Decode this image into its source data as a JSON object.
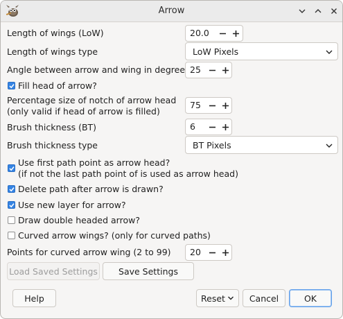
{
  "window": {
    "title": "Arrow",
    "app_icon": "gimp-wilber-icon",
    "controls": [
      "chevron-down-icon",
      "chevron-up-icon",
      "close-icon"
    ]
  },
  "fields": {
    "length_of_wings": {
      "label": "Length of wings (LoW)",
      "value": "20.0"
    },
    "length_of_wings_type": {
      "label": "Length of wings type",
      "value": "LoW Pixels"
    },
    "angle": {
      "label": "Angle between arrow and wing in degrees",
      "value": "25"
    },
    "fill_head": {
      "label": "Fill head of arrow?",
      "checked": true
    },
    "notch": {
      "label_line1": "Percentage size of notch of arrow head",
      "label_line2": "(only valid if head of arrow is filled)",
      "value": "75"
    },
    "brush_thickness": {
      "label": "Brush thickness (BT)",
      "value": "6"
    },
    "brush_thickness_type": {
      "label": "Brush thickness type",
      "value": "BT Pixels"
    },
    "use_first_point": {
      "label_line1": "Use first path point as arrow head?",
      "label_line2": "(if not the last path point of is used as arrow head)",
      "checked": true
    },
    "delete_path": {
      "label": "Delete path after arrow is drawn?",
      "checked": true
    },
    "new_layer": {
      "label": "Use new layer for arrow?",
      "checked": true
    },
    "double_headed": {
      "label": "Draw double headed arrow?",
      "checked": false
    },
    "curved_wings": {
      "label": "Curved arrow wings? (only for curved paths)",
      "checked": false
    },
    "curved_points": {
      "label": "Points for curved arrow wing (2 to 99)",
      "value": "20"
    }
  },
  "settings_buttons": {
    "load": "Load Saved Settings",
    "save": "Save Settings"
  },
  "footer": {
    "help": "Help",
    "reset": "Reset",
    "cancel": "Cancel",
    "ok": "OK"
  },
  "colors": {
    "accent": "#3584e4",
    "window_bg": "#f6f5f4",
    "titlebar_bg": "#ebebeb"
  }
}
